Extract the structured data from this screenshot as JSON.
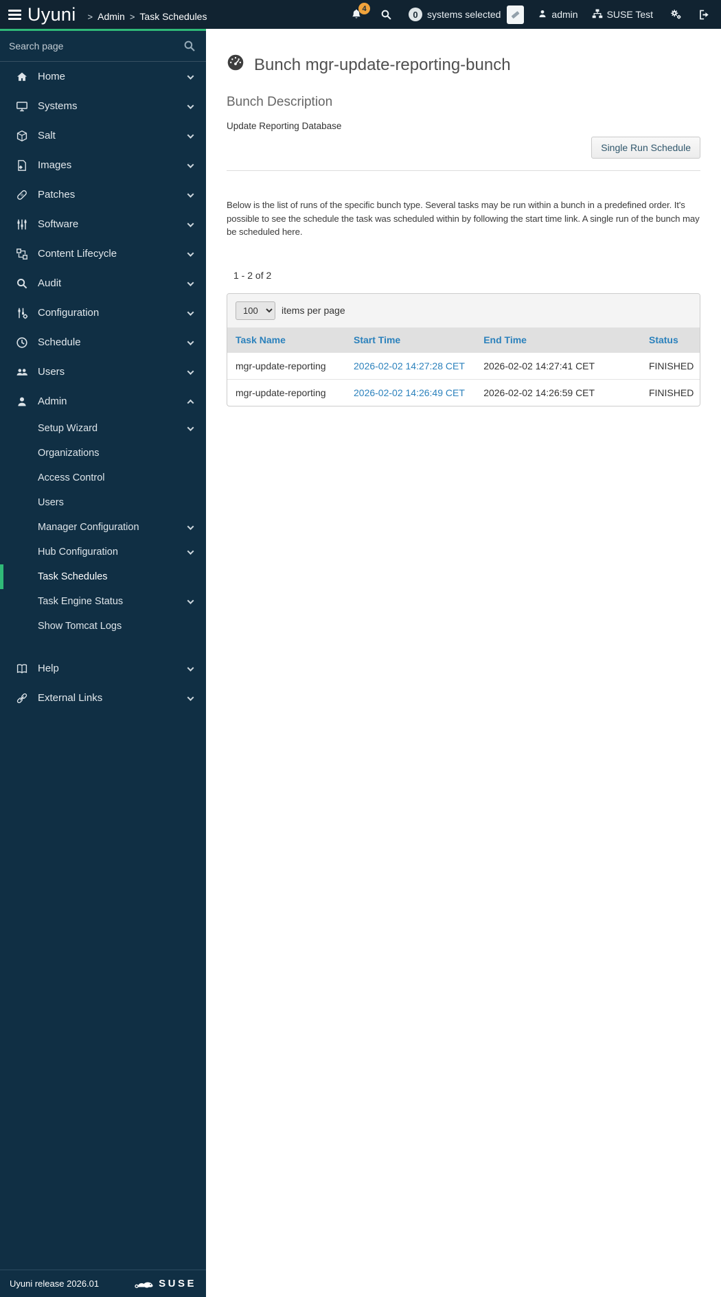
{
  "colors": {
    "accent_green": "#30ba78",
    "header_bg": "#112331",
    "sidebar_bg": "#102f44",
    "link_blue": "#2b81bc",
    "notification_badge": "#f0a33c"
  },
  "icons": {
    "menu-toggle": "hamburger bars",
    "notifications": "bell",
    "search": "magnifier",
    "clear-selection": "eraser",
    "user": "person",
    "organization": "sitemap",
    "preferences": "double gears",
    "sign-out": "door arrow",
    "page-title": "tachometer gauge",
    "suse": "chameleon"
  },
  "header": {
    "brand": "Uyuni",
    "crumb_sep": ">",
    "crumbs": [
      "Admin",
      "Task Schedules"
    ],
    "notification_count": "4",
    "systems_selected_count": "0",
    "systems_selected_label": "systems selected",
    "user": "admin",
    "org": "SUSE Test"
  },
  "sidebar": {
    "search_placeholder": "Search page",
    "items": [
      {
        "label": "Home"
      },
      {
        "label": "Systems"
      },
      {
        "label": "Salt"
      },
      {
        "label": "Images"
      },
      {
        "label": "Patches"
      },
      {
        "label": "Software"
      },
      {
        "label": "Content Lifecycle"
      },
      {
        "label": "Audit"
      },
      {
        "label": "Configuration"
      },
      {
        "label": "Schedule"
      },
      {
        "label": "Users"
      },
      {
        "label": "Admin"
      }
    ],
    "admin_children": [
      {
        "label": "Setup Wizard"
      },
      {
        "label": "Organizations"
      },
      {
        "label": "Access Control"
      },
      {
        "label": "Users"
      },
      {
        "label": "Manager Configuration"
      },
      {
        "label": "Hub Configuration"
      },
      {
        "label": "Task Schedules"
      },
      {
        "label": "Task Engine Status"
      },
      {
        "label": "Show Tomcat Logs"
      }
    ],
    "bottom_items": [
      {
        "label": "Help"
      },
      {
        "label": "External Links"
      }
    ]
  },
  "page": {
    "title": "Bunch mgr-update-reporting-bunch",
    "section_heading": "Bunch Description",
    "description": "Update Reporting Database",
    "single_run_button": "Single Run Schedule",
    "intro": "Below is the list of runs of the specific bunch type. Several tasks may be run within a bunch in a predefined order. It's possible to see the schedule the task was scheduled within by following the start time link. A single run of the bunch may be scheduled here.",
    "pagination": "1 - 2 of 2",
    "items_per_page_value": "100",
    "items_per_page_label": "items per page"
  },
  "table": {
    "columns": [
      "Task Name",
      "Start Time",
      "End Time",
      "Status"
    ],
    "rows": [
      {
        "task_name": "mgr-update-reporting",
        "start_time": "2026-02-02 14:27:28 CET",
        "end_time": "2026-02-02 14:27:41 CET",
        "status": "FINISHED"
      },
      {
        "task_name": "mgr-update-reporting",
        "start_time": "2026-02-02 14:26:49 CET",
        "end_time": "2026-02-02 14:26:59 CET",
        "status": "FINISHED"
      }
    ]
  },
  "footer": {
    "release_prefix": "Uyuni release",
    "release_version": "2026.01",
    "suse": "SUSE"
  }
}
